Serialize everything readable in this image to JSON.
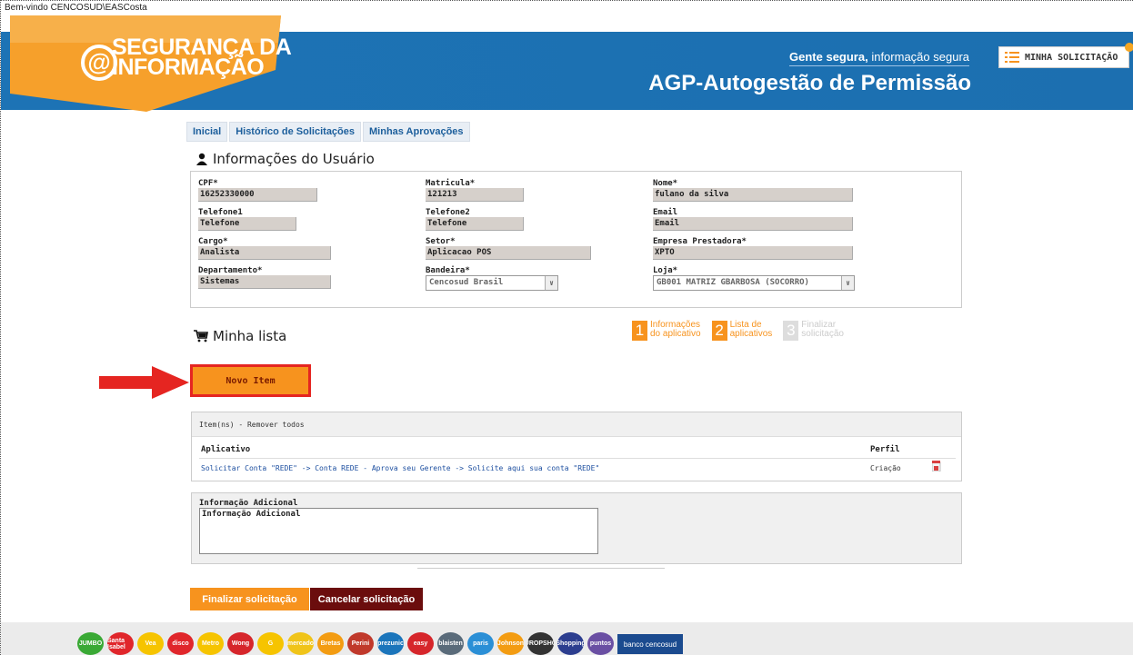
{
  "welcome": "Bem-vindo CENCOSUD\\EASCosta",
  "header": {
    "logo_line1": "SEGURANÇA DA",
    "logo_line2": "INFORMAÇÃO",
    "logo_at": "@",
    "tagline_bold": "Gente segura,",
    "tagline_rest": " informação segura",
    "app_title": "AGP-Autogestão de Permissão",
    "minha_solicitacao": "MINHA SOLICITAÇÃO"
  },
  "tabs": [
    "Inicial",
    "Histórico de Solicitações",
    "Minhas Aprovações"
  ],
  "user_info": {
    "title": "Informações do Usuário",
    "fields": {
      "cpf": {
        "label": "CPF*",
        "value": "16252330000"
      },
      "matricula": {
        "label": "Matricula*",
        "value": "121213"
      },
      "nome": {
        "label": "Nome*",
        "value": "fulano da silva"
      },
      "telefone1": {
        "label": "Telefone1",
        "value": "Telefone"
      },
      "telefone2": {
        "label": "Telefone2",
        "value": "Telefone"
      },
      "email": {
        "label": "Email",
        "value": "Email"
      },
      "cargo": {
        "label": "Cargo*",
        "value": "Analista"
      },
      "setor": {
        "label": "Setor*",
        "value": "Aplicacao POS"
      },
      "empresa": {
        "label": "Empresa Prestadora*",
        "value": "XPTO"
      },
      "departamento": {
        "label": "Departamento*",
        "value": "Sistemas"
      },
      "bandeira": {
        "label": "Bandeira*",
        "value": "Cencosud Brasil"
      },
      "loja": {
        "label": "Loja*",
        "value": "GB001 MATRIZ GBARBOSA (SOCORRO)"
      }
    }
  },
  "minha_lista": {
    "title": "Minha lista"
  },
  "steps": [
    {
      "num": "1",
      "line1": "Informações",
      "line2": "do aplicativo",
      "color": "#f7931e"
    },
    {
      "num": "2",
      "line1": "Lista de",
      "line2": "aplicativos",
      "color": "#f7931e"
    },
    {
      "num": "3",
      "line1": "Finalizar",
      "line2": "solicitação",
      "color": "#dddddd"
    }
  ],
  "novo_item": "Novo Item",
  "items": {
    "header": "Item(ns) - Remover todos",
    "col_aplicativo": "Aplicativo",
    "col_perfil": "Perfil",
    "rows": [
      {
        "aplicativo": "Solicitar Conta \"REDE\" -> Conta REDE - Aprova seu Gerente -> Solicite aqui sua conta \"REDE\"",
        "perfil": "Criação"
      }
    ]
  },
  "info_adicional": {
    "label": "Informação Adicional",
    "value": "Informação Adicional"
  },
  "buttons": {
    "finalizar": "Finalizar solicitação",
    "cancelar": "Cancelar solicitação"
  },
  "brands": [
    {
      "name": "JUMBO",
      "color": "#3aa935"
    },
    {
      "name": "Santa Isabel",
      "color": "#e0262b"
    },
    {
      "name": "Vea",
      "color": "#f6c400"
    },
    {
      "name": "disco",
      "color": "#e0262b"
    },
    {
      "name": "Metro",
      "color": "#f6c400"
    },
    {
      "name": "Wong",
      "color": "#d6262b"
    },
    {
      "name": "G",
      "color": "#f6c400"
    },
    {
      "name": "mercado",
      "color": "#f0c419"
    },
    {
      "name": "Bretas",
      "color": "#f39c12"
    },
    {
      "name": "Perini",
      "color": "#c0392b"
    },
    {
      "name": "prezunic",
      "color": "#1b75bb"
    },
    {
      "name": "easy",
      "color": "#d6262b"
    },
    {
      "name": "blaisten",
      "color": "#5a6b7a"
    },
    {
      "name": "paris",
      "color": "#2b8fd6"
    },
    {
      "name": "Johnson",
      "color": "#f39c12"
    },
    {
      "name": "EUROPSHOP",
      "color": "#333333"
    },
    {
      "name": "Shopping",
      "color": "#2c3e8f"
    },
    {
      "name": "puntos",
      "color": "#6a4fa3"
    }
  ],
  "banco": "banco cencosud"
}
